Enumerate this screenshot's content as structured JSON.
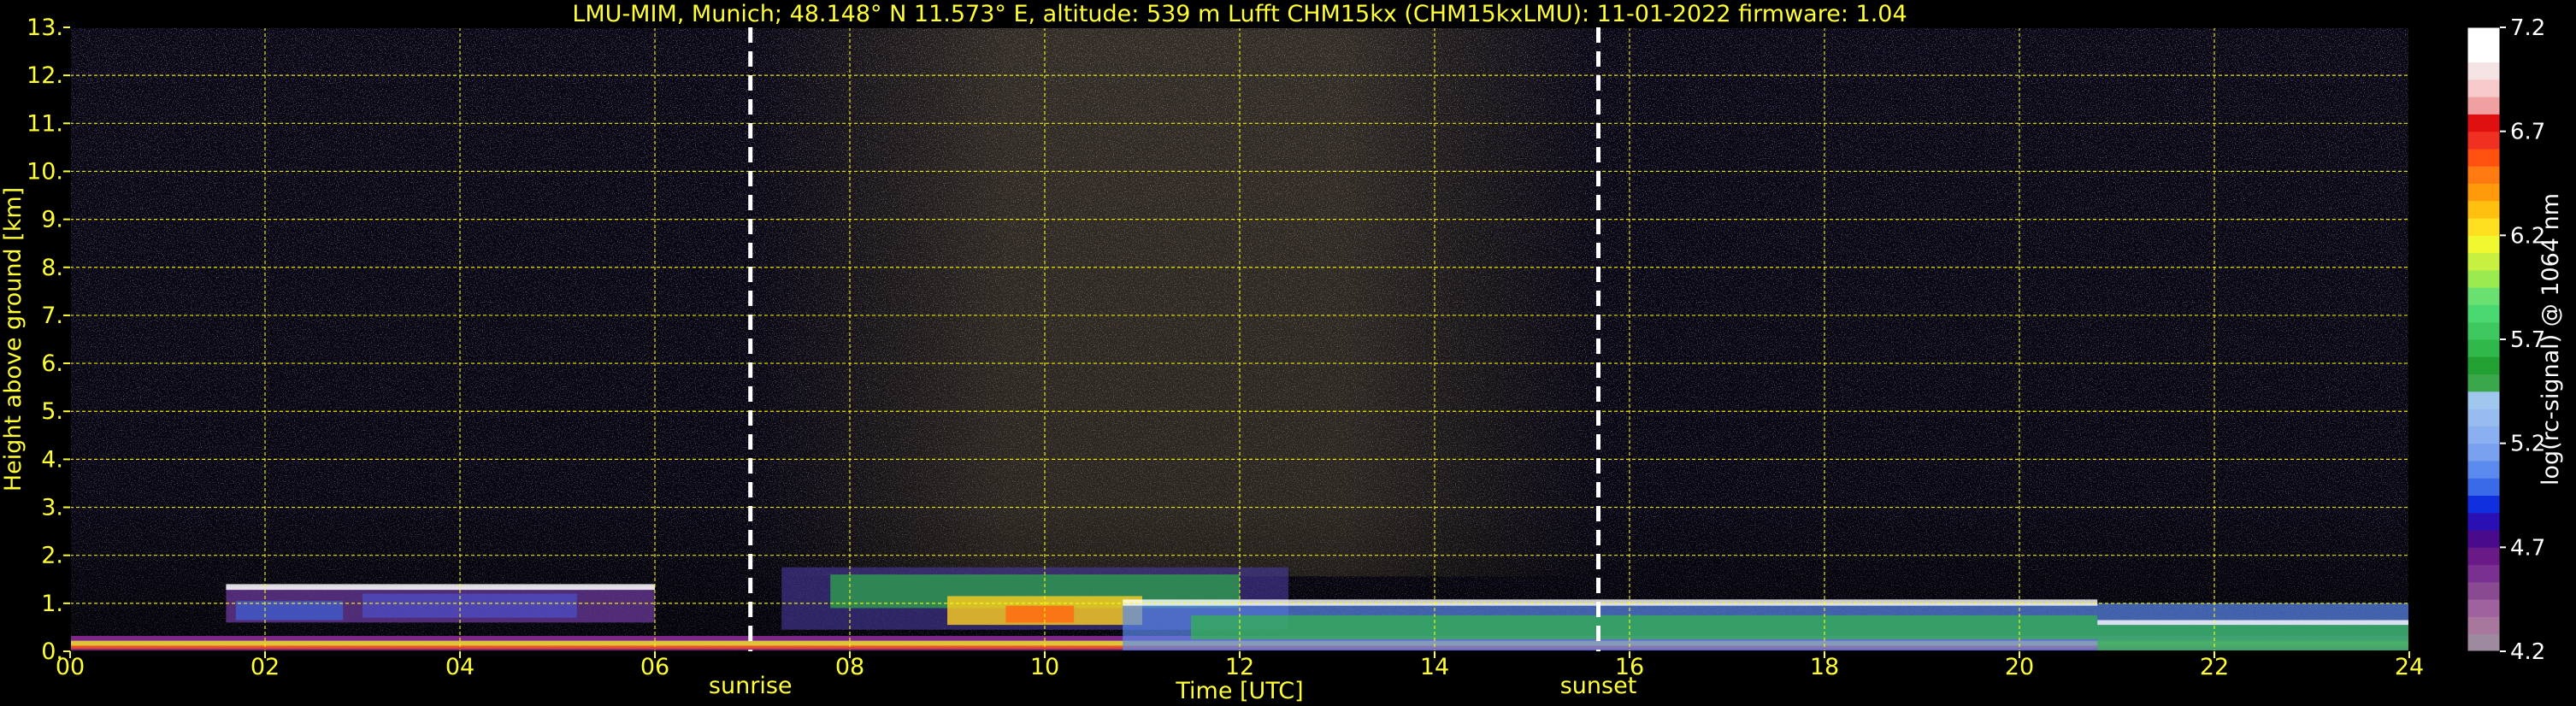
{
  "chart_data": {
    "type": "heatmap",
    "title": "LMU-MIM, Munich; 48.148° N 11.573° E, altitude: 539 m    Lufft CHM15kx (CHM15kxLMU): 11-01-2022    firmware: 1.04",
    "xlabel": "Time [UTC]",
    "ylabel": "Height above ground [km]",
    "xlim": [
      0,
      24
    ],
    "ylim": [
      0,
      13
    ],
    "xticks": [
      0,
      2,
      4,
      6,
      8,
      10,
      12,
      14,
      16,
      18,
      20,
      22,
      24
    ],
    "xtick_labels": [
      "00",
      "02",
      "04",
      "06",
      "08",
      "10",
      "12",
      "14",
      "16",
      "18",
      "20",
      "22",
      "24"
    ],
    "yticks": [
      0,
      1,
      2,
      3,
      4,
      5,
      6,
      7,
      8,
      9,
      10,
      11,
      12,
      13
    ],
    "ytick_labels": [
      "0.",
      "1.",
      "2.",
      "3.",
      "4.",
      "5.",
      "6.",
      "7.",
      "8.",
      "9.",
      "10.",
      "11.",
      "12.",
      "13."
    ],
    "grid": true,
    "grid_color": "#ffff00",
    "events": [
      {
        "label": "sunrise",
        "x": 6.98
      },
      {
        "label": "sunset",
        "x": 15.68
      }
    ],
    "colorbar": {
      "label": "log(rc-signal) @ 1064 nm",
      "range": [
        4.2,
        7.2
      ],
      "ticks": [
        4.2,
        4.7,
        5.2,
        5.7,
        6.2,
        6.7,
        7.2
      ],
      "tick_labels": [
        "4.2",
        "4.7",
        "5.2",
        "5.7",
        "6.2",
        "6.7",
        "7.2"
      ],
      "colors": [
        "#9e8a9e",
        "#a8779e",
        "#a0629e",
        "#8a4a92",
        "#7a3090",
        "#6a1a86",
        "#4a0a8c",
        "#2a10b4",
        "#1030e0",
        "#3a6ae8",
        "#5a8aee",
        "#7aa0f0",
        "#8ab0f2",
        "#98bcf0",
        "#a0c8ee",
        "#3aa84a",
        "#22a032",
        "#30b84a",
        "#40c860",
        "#4ad870",
        "#6ae070",
        "#9aea50",
        "#c8f040",
        "#f0f830",
        "#ffe020",
        "#ffc010",
        "#ff9a0a",
        "#ff7a10",
        "#ff5010",
        "#f03020",
        "#e01010",
        "#f0a0a0",
        "#f6caca",
        "#f6e4e4",
        "#ffffff",
        "#ffffff"
      ]
    },
    "layers": [
      {
        "kind": "surface_aerosol",
        "from": 0,
        "to": 24,
        "height_km": [
          0.05,
          0.35
        ]
      },
      {
        "kind": "cloud_deck_night",
        "from": 1.6,
        "to": 6.0,
        "height_km": [
          0.65,
          1.4
        ]
      },
      {
        "kind": "aerosol_layer_day",
        "from": 7.2,
        "to": 12.6,
        "height_km": [
          0.5,
          1.7
        ]
      },
      {
        "kind": "boundary_layer",
        "from": 10.8,
        "to": 24,
        "height_km": [
          0.0,
          1.2
        ]
      }
    ]
  }
}
